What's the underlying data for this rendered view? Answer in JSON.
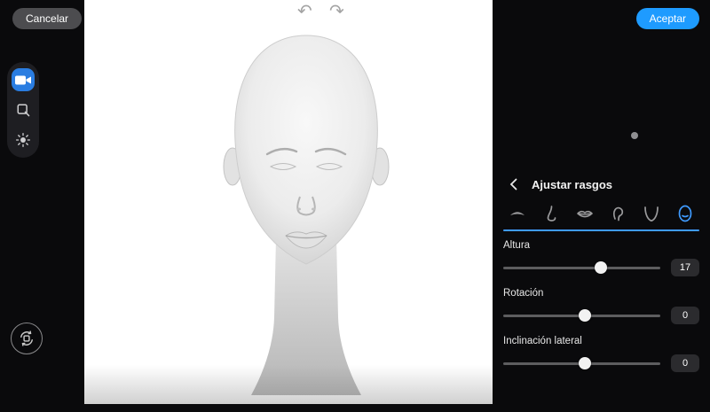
{
  "window": {
    "cancel_label": "Cancelar",
    "accept_label": "Aceptar"
  },
  "icons": {
    "undo": "↶",
    "redo": "↷",
    "back": "chevron-left",
    "tools": [
      "camera",
      "crop",
      "brightness"
    ],
    "reset": "reset-rotation",
    "tabs": [
      "eyebrows",
      "nose",
      "lips",
      "ears",
      "jaw",
      "head"
    ]
  },
  "left_toolbar": {
    "selected_tool": "camera"
  },
  "panel": {
    "title": "Ajustar rasgos",
    "selected_tab": "head",
    "sliders": [
      {
        "label": "Altura",
        "value": "17",
        "percent": 62
      },
      {
        "label": "Rotación",
        "value": "0",
        "percent": 52
      },
      {
        "label": "Inclinación lateral",
        "value": "0",
        "percent": 52
      }
    ]
  },
  "colors": {
    "accent_blue": "#3f9bff",
    "accept_blue": "#1e9bff",
    "tool_blue": "#2a7de1",
    "canvas_white": "#ffffff"
  }
}
